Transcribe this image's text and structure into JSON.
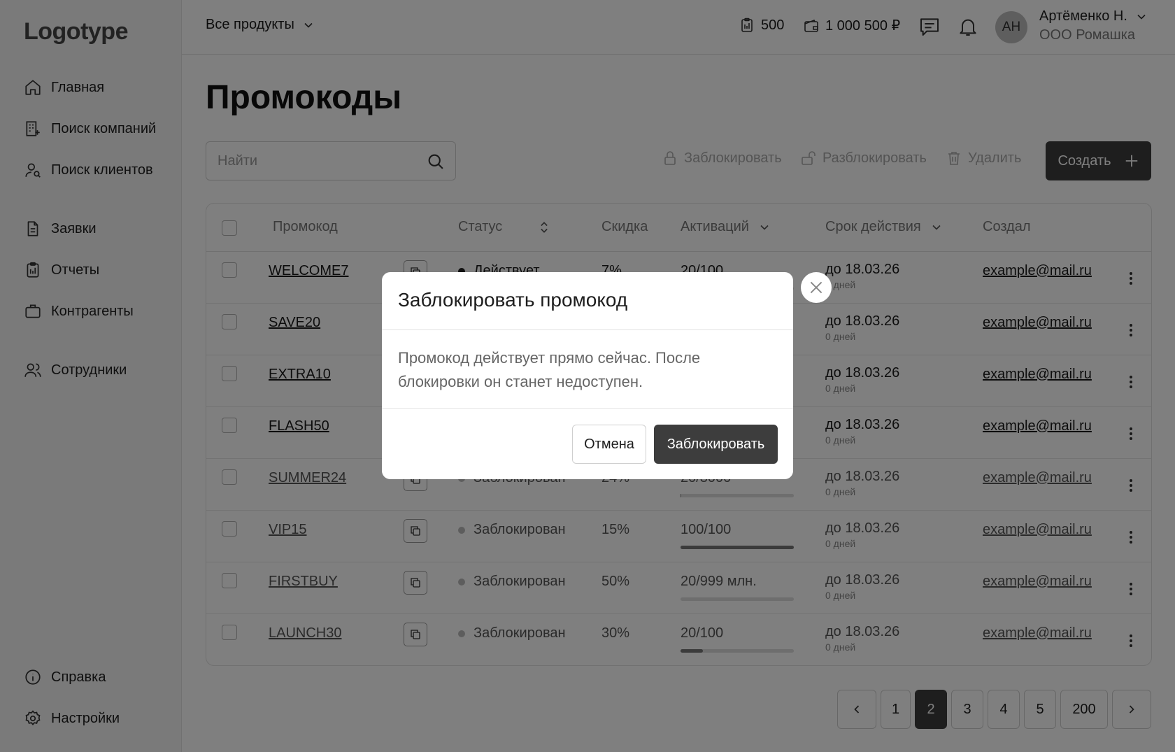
{
  "logo": "Logotype",
  "sidebar": {
    "items": [
      {
        "label": "Главная",
        "icon": "home-icon"
      },
      {
        "label": "Поиск компаний",
        "icon": "building-icon"
      },
      {
        "label": "Поиск клиентов",
        "icon": "user-search-icon"
      },
      {
        "label": "Заявки",
        "icon": "document-icon"
      },
      {
        "label": "Отчеты",
        "icon": "clipboard-icon"
      },
      {
        "label": "Контрагенты",
        "icon": "briefcase-icon"
      },
      {
        "label": "Сотрудники",
        "icon": "users-icon"
      }
    ],
    "bottom": [
      {
        "label": "Справка",
        "icon": "info-icon"
      },
      {
        "label": "Настройки",
        "icon": "gear-icon"
      }
    ]
  },
  "header": {
    "products": "Все продукты",
    "count": "500",
    "balance": "1 000 500 ₽",
    "avatar": "АН",
    "user_name": "Артёменко Н.",
    "user_org": "ООО Ромашка"
  },
  "page": {
    "title": "Промокоды",
    "search_placeholder": "Найти",
    "actions": {
      "block": "Заблокировать",
      "unblock": "Разблокировать",
      "delete": "Удалить"
    },
    "create": "Создать"
  },
  "table": {
    "columns": {
      "code": "Промокод",
      "status": "Статус",
      "discount": "Скидка",
      "activations": "Активаций",
      "expiry": "Срок действия",
      "author": "Создал"
    },
    "rows": [
      {
        "code": "WELCOME7",
        "status": "Действует",
        "discount": "7%",
        "activations": "20/100",
        "progress": 0.2,
        "expiry": "до 18.03.26",
        "days": "0 дней",
        "author": "example@mail.ru",
        "blocked": false
      },
      {
        "code": "SAVE20",
        "status": "",
        "discount": "",
        "activations": "",
        "progress": 0,
        "expiry": "до 18.03.26",
        "days": "0 дней",
        "author": "example@mail.ru",
        "blocked": false
      },
      {
        "code": "EXTRA10",
        "status": "",
        "discount": "",
        "activations": "",
        "progress": 0,
        "expiry": "до 18.03.26",
        "days": "0 дней",
        "author": "example@mail.ru",
        "blocked": false
      },
      {
        "code": "FLASH50",
        "status": "",
        "discount": "",
        "activations": "",
        "progress": 0,
        "expiry": "до 18.03.26",
        "days": "0 дней",
        "author": "example@mail.ru",
        "blocked": false
      },
      {
        "code": "SUMMER24",
        "status": "Заблокирован",
        "discount": "24%",
        "activations": "20/3000",
        "progress": 0.0067,
        "expiry": "до 18.03.26",
        "days": "0 дней",
        "author": "example@mail.ru",
        "blocked": true
      },
      {
        "code": "VIP15",
        "status": "Заблокирован",
        "discount": "15%",
        "activations": "100/100",
        "progress": 1.0,
        "expiry": "до 18.03.26",
        "days": "0 дней",
        "author": "example@mail.ru",
        "blocked": true
      },
      {
        "code": "FIRSTBUY",
        "status": "Заблокирован",
        "discount": "50%",
        "activations": "20/999 млн.",
        "progress": 0.0,
        "expiry": "до 18.03.26",
        "days": "0 дней",
        "author": "example@mail.ru",
        "blocked": true
      },
      {
        "code": "LAUNCH30",
        "status": "Заблокирован",
        "discount": "30%",
        "activations": "20/100",
        "progress": 0.2,
        "expiry": "до 18.03.26",
        "days": "0 дней",
        "author": "example@mail.ru",
        "blocked": true
      }
    ]
  },
  "pagination": {
    "pages": [
      "1",
      "2",
      "3",
      "4",
      "5",
      "200"
    ],
    "current": "2"
  },
  "modal": {
    "title": "Заблокировать промокод",
    "body": "Промокод действует прямо сейчас. После блокировки он станет недоступен.",
    "cancel": "Отмена",
    "confirm": "Заблокировать"
  }
}
